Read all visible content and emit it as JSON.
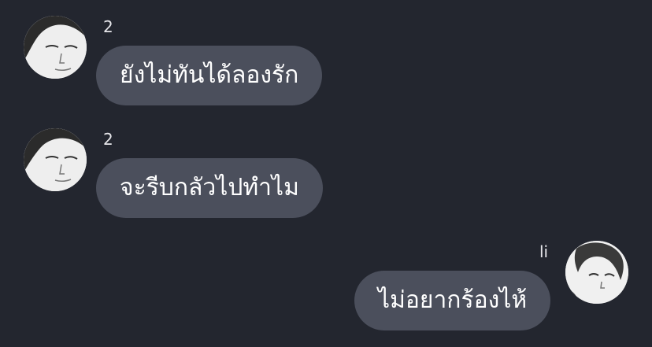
{
  "messages": [
    {
      "sender": "2",
      "text": "ยังไม่ทันได้ลองรัก",
      "side": "incoming",
      "avatar": "portrait-avatar-icon"
    },
    {
      "sender": "2",
      "text": "จะรีบกลัวไปทำไม",
      "side": "incoming",
      "avatar": "portrait-avatar-icon"
    },
    {
      "sender": "li",
      "text": "ไม่อยากร้องไห้",
      "side": "outgoing",
      "avatar": "portrait-avatar-icon"
    }
  ],
  "colors": {
    "background": "#23262f",
    "bubble": "#4b4f5c",
    "text": "#ffffff",
    "sender_text": "#e6e6ea"
  }
}
